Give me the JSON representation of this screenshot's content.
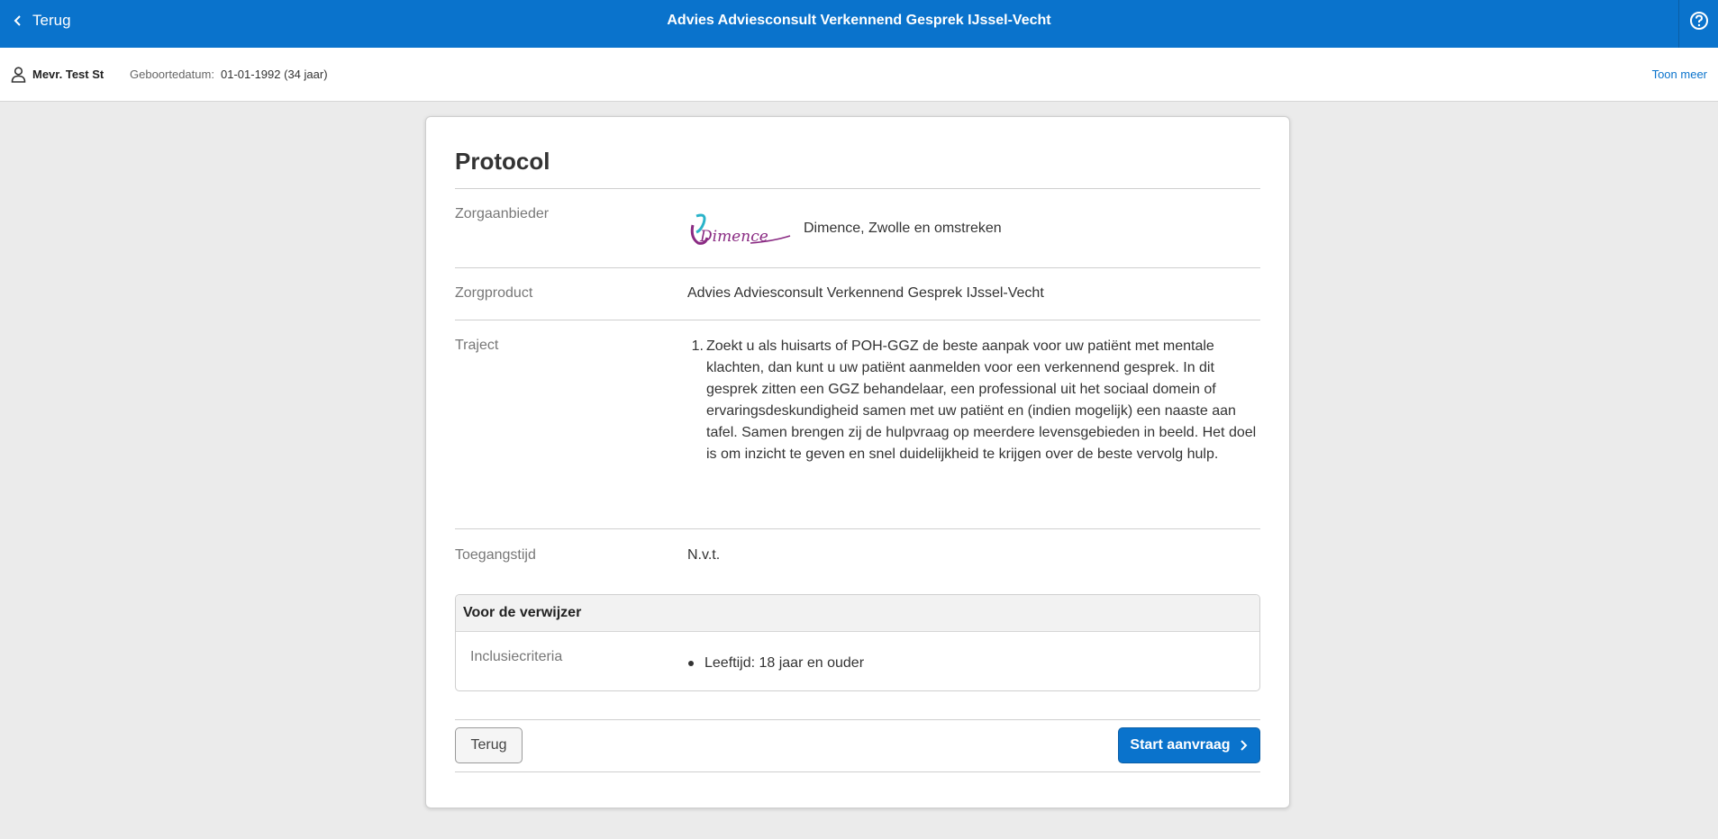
{
  "header": {
    "back_label": "Terug",
    "title": "Advies Adviesconsult Verkennend Gesprek IJssel-Vecht",
    "help_icon": "help-icon",
    "accent_color": "#0a73cc"
  },
  "patient": {
    "name": "Mevr. Test St",
    "dob_label": "Geboortedatum:",
    "dob_value": "01-01-1992 (34 jaar)",
    "toon_meer": "Toon meer"
  },
  "protocol": {
    "title": "Protocol",
    "zorgaanbieder_label": "Zorgaanbieder",
    "zorgaanbieder_logo_text": "Dimence",
    "zorgaanbieder_value": "Dimence, Zwolle en omstreken",
    "zorgproduct_label": "Zorgproduct",
    "zorgproduct_value": "Advies Adviesconsult Verkennend Gesprek IJssel-Vecht",
    "traject_label": "Traject",
    "traject_items": [
      {
        "num": "1.",
        "text": "Zoekt u als huisarts of POH-GGZ de beste aanpak voor uw patiënt met mentale klachten, dan kunt u uw patiënt aanmelden voor een verkennend gesprek. In dit gesprek zitten een GGZ behandelaar, een professional uit het sociaal domein of ervaringsdeskundigheid samen met uw patiënt en (indien mogelijk) een naaste aan tafel. Samen brengen zij de hulpvraag op meerdere levensgebieden in beeld. Het doel is om inzicht te geven en snel duidelijkheid te krijgen over de beste vervolg hulp."
      }
    ],
    "toegangstijd_label": "Toegangstijd",
    "toegangstijd_value": "N.v.t."
  },
  "verwijzer": {
    "title": "Voor de verwijzer",
    "inclusie_label": "Inclusiecriteria",
    "inclusie_items": [
      "Leeftijd: 18 jaar en ouder"
    ]
  },
  "actions": {
    "back_label": "Terug",
    "start_label": "Start aanvraag"
  }
}
